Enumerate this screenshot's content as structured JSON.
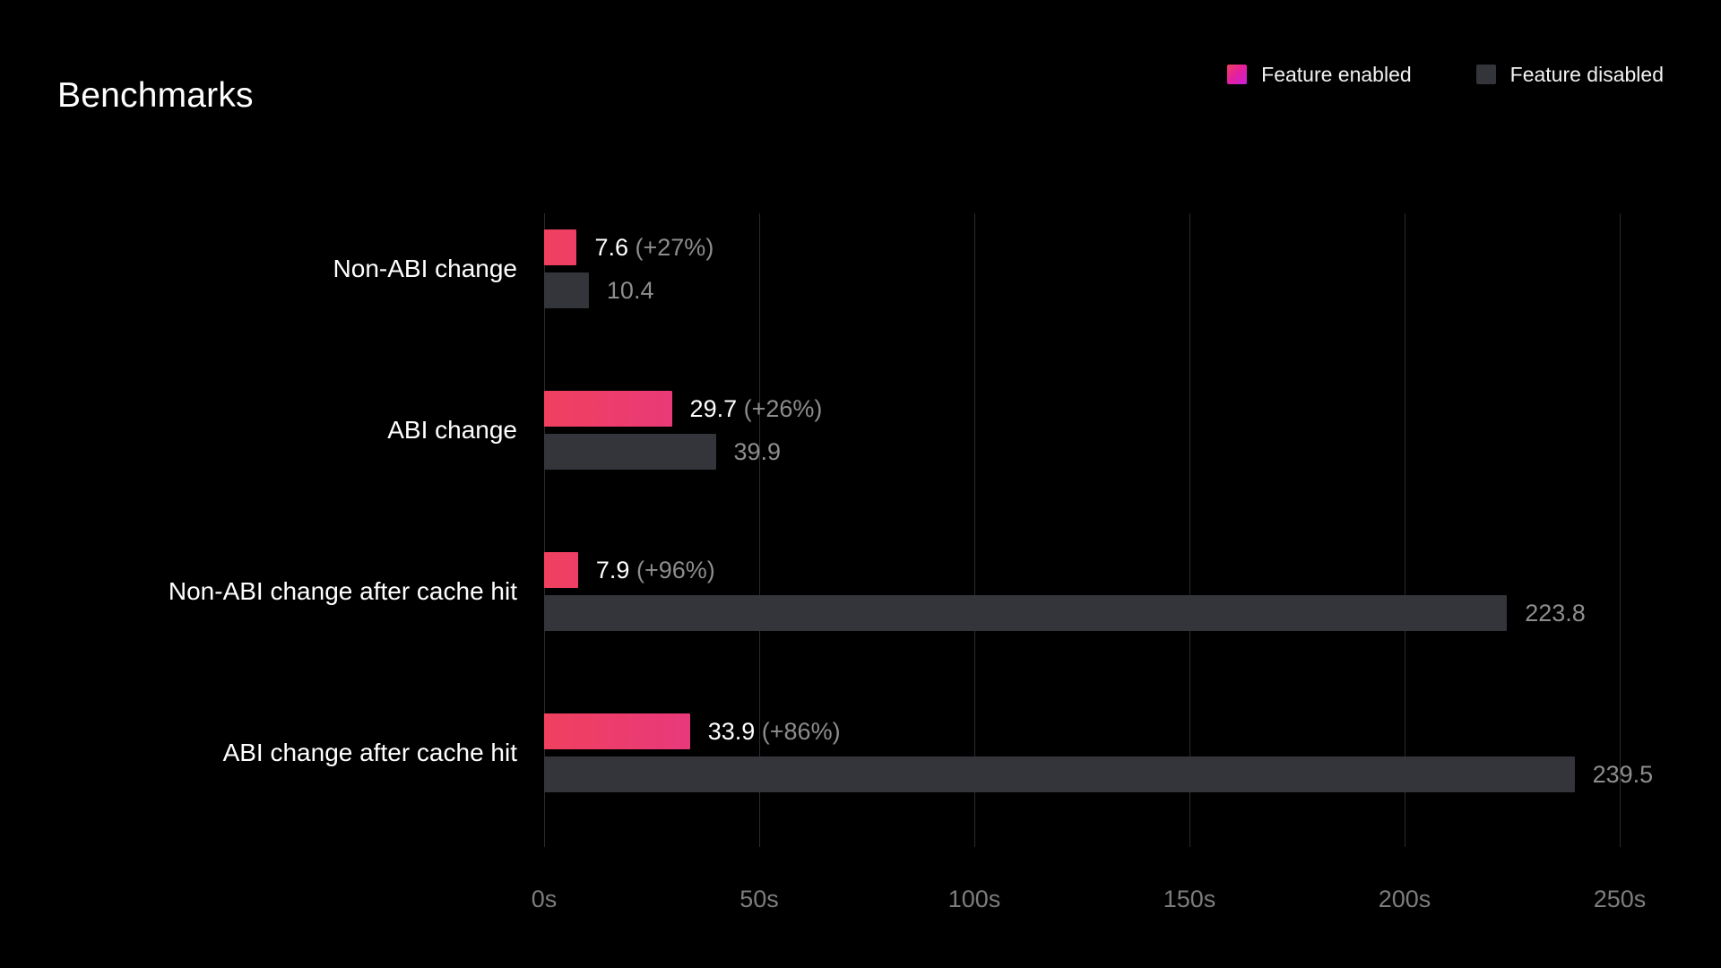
{
  "header": {
    "title": "Benchmarks",
    "legend": [
      {
        "label": "Feature enabled",
        "swatch": "gradient",
        "color": "#e5219a"
      },
      {
        "label": "Feature disabled",
        "swatch": "solid",
        "color": "#34353b"
      }
    ]
  },
  "chart_data": {
    "type": "bar",
    "orientation": "horizontal",
    "title": "Benchmarks",
    "xlabel": "",
    "ylabel": "",
    "xlim": [
      0,
      250
    ],
    "x_unit": "s",
    "grid": true,
    "legend_position": "top-right",
    "tick_labels": [
      "0s",
      "50s",
      "100s",
      "150s",
      "200s",
      "250s"
    ],
    "tick_values": [
      0,
      50,
      100,
      150,
      200,
      250
    ],
    "categories": [
      "Non-ABI change",
      "ABI change",
      "Non-ABI change after cache hit",
      "ABI change after cache hit"
    ],
    "series": [
      {
        "name": "Feature enabled",
        "values": [
          7.6,
          29.7,
          7.9,
          33.9
        ],
        "labels": [
          "7.6",
          "29.7",
          "7.9",
          "33.9"
        ],
        "deltas": [
          "(+27%)",
          "(+26%)",
          "(+96%)",
          "(+86%)"
        ]
      },
      {
        "name": "Feature disabled",
        "values": [
          10.4,
          39.9,
          223.8,
          239.5
        ],
        "labels": [
          "10.4",
          "39.9",
          "223.8",
          "239.5"
        ],
        "deltas": [
          "",
          "",
          "",
          ""
        ]
      }
    ],
    "colors": {
      "background": "#000000",
      "gridline": "#2b2b2d",
      "enabled_gradient_start": "#f0405f",
      "enabled_gradient_mid": "#d426c8",
      "enabled_gradient_end": "#6f5cf5",
      "disabled": "#34353b",
      "value_text": "#ffffff",
      "delta_text": "#8d8d8d",
      "tick_text": "#7d7d7d",
      "category_text": "#ffffff"
    }
  }
}
